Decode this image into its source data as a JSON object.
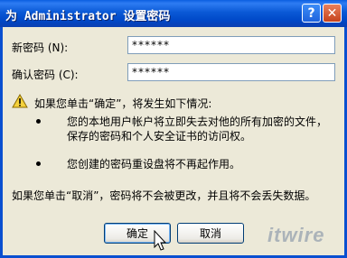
{
  "window": {
    "title": "为 Administrator 设置密码"
  },
  "titlebar_buttons": {
    "help": "?",
    "close": "✕"
  },
  "form": {
    "new_password_label": "新密码 (N):",
    "new_password_value": "******",
    "confirm_password_label": "确认密码 (C):",
    "confirm_password_value": "******"
  },
  "warning": {
    "intro": "如果您单击“确定”，将发生如下情况:",
    "bullets": [
      {
        "line1": "您的本地用户帐户将立即失去对他的所有加密的文件，",
        "line2": "保存的密码和个人安全证书的访问权。"
      },
      {
        "line1": "您创建的密码重设盘将不再起作用。"
      }
    ],
    "cancel_note": "如果您单击“取消”，密码将不会被更改，并且将不会丢失数据。"
  },
  "buttons": {
    "ok": "确定",
    "cancel": "取消"
  },
  "watermark": "itwire"
}
